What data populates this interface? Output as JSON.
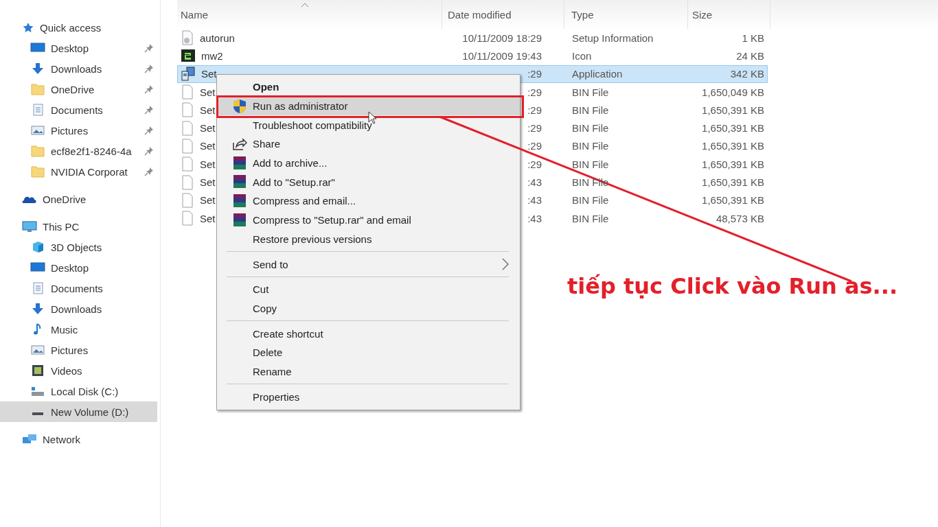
{
  "sidebar": {
    "sections": [
      {
        "label": "Quick access",
        "selected": false,
        "children": [
          {
            "label": "Desktop",
            "pinned": true,
            "selected": false
          },
          {
            "label": "Downloads",
            "pinned": true,
            "selected": false
          },
          {
            "label": "OneDrive",
            "pinned": true,
            "selected": false
          },
          {
            "label": "Documents",
            "pinned": true,
            "selected": false
          },
          {
            "label": "Pictures",
            "pinned": true,
            "selected": false
          },
          {
            "label": "ecf8e2f1-8246-4a",
            "pinned": true,
            "selected": false
          },
          {
            "label": "NVIDIA Corporat",
            "pinned": true,
            "selected": false
          }
        ]
      },
      {
        "label": "OneDrive",
        "selected": false
      },
      {
        "label": "This PC",
        "selected": false,
        "children": [
          {
            "label": "3D Objects",
            "pinned": false,
            "selected": false
          },
          {
            "label": "Desktop",
            "pinned": false,
            "selected": false
          },
          {
            "label": "Documents",
            "pinned": false,
            "selected": false
          },
          {
            "label": "Downloads",
            "pinned": false,
            "selected": false
          },
          {
            "label": "Music",
            "pinned": false,
            "selected": false
          },
          {
            "label": "Pictures",
            "pinned": false,
            "selected": false
          },
          {
            "label": "Videos",
            "pinned": false,
            "selected": false
          },
          {
            "label": "Local Disk (C:)",
            "pinned": false,
            "selected": false
          },
          {
            "label": "New Volume (D:)",
            "pinned": false,
            "selected": true
          }
        ]
      },
      {
        "label": "Network",
        "selected": false
      }
    ]
  },
  "table": {
    "columns": [
      "Name",
      "Date modified",
      "Type",
      "Size"
    ],
    "sort_ascending": true,
    "rows": [
      {
        "name": "autorun",
        "date": "10/11/2009 18:29",
        "type": "Setup Information",
        "size": "1 KB",
        "selected": false
      },
      {
        "name": "mw2",
        "date": "10/11/2009 19:43",
        "type": "Icon",
        "size": "24 KB",
        "selected": false
      },
      {
        "name": "Set",
        "date": ":29",
        "type": "Application",
        "size": "342 KB",
        "selected": true
      },
      {
        "name": "Set",
        "date": ":29",
        "type": "BIN File",
        "size": "1,650,049 KB",
        "selected": false
      },
      {
        "name": "Set",
        "date": ":29",
        "type": "BIN File",
        "size": "1,650,391 KB",
        "selected": false
      },
      {
        "name": "Set",
        "date": ":29",
        "type": "BIN File",
        "size": "1,650,391 KB",
        "selected": false
      },
      {
        "name": "Set",
        "date": ":29",
        "type": "BIN File",
        "size": "1,650,391 KB",
        "selected": false
      },
      {
        "name": "Set",
        "date": ":29",
        "type": "BIN File",
        "size": "1,650,391 KB",
        "selected": false
      },
      {
        "name": "Set",
        "date": ":43",
        "type": "BIN File",
        "size": "1,650,391 KB",
        "selected": false
      },
      {
        "name": "Set",
        "date": ":43",
        "type": "BIN File",
        "size": "1,650,391 KB",
        "selected": false
      },
      {
        "name": "Set",
        "date": ":43",
        "type": "BIN File",
        "size": "48,573 KB",
        "selected": false
      }
    ]
  },
  "context_menu": {
    "items": [
      {
        "kind": "item",
        "label": "Open",
        "default": true,
        "selected": false,
        "submenu": false
      },
      {
        "kind": "item",
        "label": "Run as administrator",
        "default": false,
        "selected": true,
        "submenu": false
      },
      {
        "kind": "item",
        "label": "Troubleshoot compatibility",
        "default": false,
        "selected": false,
        "submenu": false
      },
      {
        "kind": "item",
        "label": "Share",
        "default": false,
        "selected": false,
        "submenu": false
      },
      {
        "kind": "item",
        "label": "Add to archive...",
        "default": false,
        "selected": false,
        "submenu": false
      },
      {
        "kind": "item",
        "label": "Add to \"Setup.rar\"",
        "default": false,
        "selected": false,
        "submenu": false
      },
      {
        "kind": "item",
        "label": "Compress and email...",
        "default": false,
        "selected": false,
        "submenu": false
      },
      {
        "kind": "item",
        "label": "Compress to \"Setup.rar\" and email",
        "default": false,
        "selected": false,
        "submenu": false
      },
      {
        "kind": "item",
        "label": "Restore previous versions",
        "default": false,
        "selected": false,
        "submenu": false
      },
      {
        "kind": "separator"
      },
      {
        "kind": "item",
        "label": "Send to",
        "default": false,
        "selected": false,
        "submenu": true
      },
      {
        "kind": "separator"
      },
      {
        "kind": "item",
        "label": "Cut",
        "default": false,
        "selected": false,
        "submenu": false
      },
      {
        "kind": "item",
        "label": "Copy",
        "default": false,
        "selected": false,
        "submenu": false
      },
      {
        "kind": "separator"
      },
      {
        "kind": "item",
        "label": "Create shortcut",
        "default": false,
        "selected": false,
        "submenu": false
      },
      {
        "kind": "item",
        "label": "Delete",
        "default": false,
        "selected": false,
        "submenu": false
      },
      {
        "kind": "item",
        "label": "Rename",
        "default": false,
        "selected": false,
        "submenu": false
      },
      {
        "kind": "separator"
      },
      {
        "kind": "item",
        "label": "Properties",
        "default": false,
        "selected": false,
        "submenu": false
      }
    ]
  },
  "annotation": {
    "text": "tiếp tục Click vào Run as..."
  }
}
